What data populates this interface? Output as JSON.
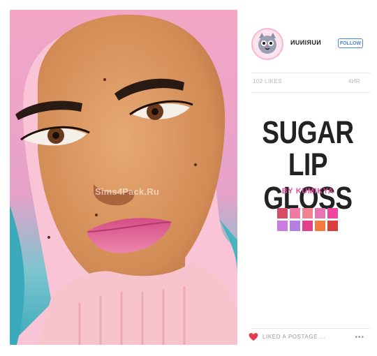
{
  "image": {
    "watermark": "Sims4Pack.Ru",
    "colors": {
      "hair_pink": "#f4a8c6",
      "hair_teal": "#3fb0bd",
      "skin": "#d9925c",
      "sweater": "#f7c7cf",
      "background_pink": "#f9c2d4"
    }
  },
  "post": {
    "username": "ИUИIЯUИ",
    "follow_label": "FOLLOW",
    "notes_left": "102 LIKES",
    "notes_right": "4ИR",
    "title_line1": "SUGAR",
    "title_line2": "LIP GLOSS",
    "byline": "BY KUMIKYA",
    "swatch_colors": [
      "#d94a64",
      "#f07aa3",
      "#f2838f",
      "#e874b8",
      "#f046a0",
      "#c97be0",
      "#b57fe3",
      "#e33f8a",
      "#f27a3c",
      "#d93d3d"
    ],
    "reblog_text": "LIKED A POSTAGE ...",
    "more_label": "•••",
    "icons": {
      "avatar": "cat-avatar-icon",
      "heart": "heart-icon"
    },
    "accent_color": "#e64d9d",
    "follow_color": "#4c86d6"
  }
}
